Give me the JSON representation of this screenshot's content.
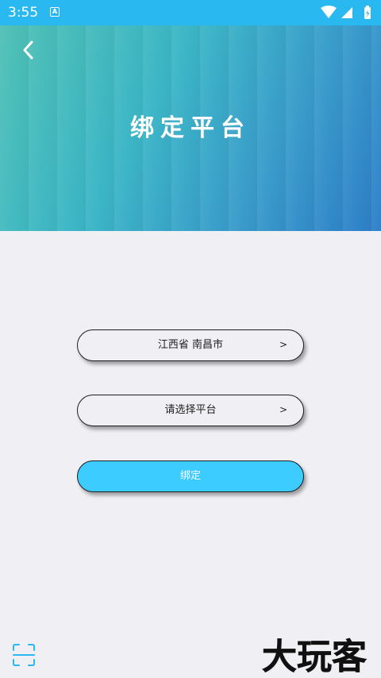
{
  "status_bar": {
    "time": "3:55",
    "notification_icon": "A"
  },
  "header": {
    "title": "绑定平台"
  },
  "form": {
    "region_label": "江西省 南昌市",
    "platform_label": "请选择平台",
    "arrow": ">",
    "bind_label": "绑定"
  },
  "watermark": {
    "text": "大玩客"
  },
  "colors": {
    "status_bar": "#2AB8F0",
    "accent": "#3DCCFF",
    "background": "#EFEFF4"
  }
}
